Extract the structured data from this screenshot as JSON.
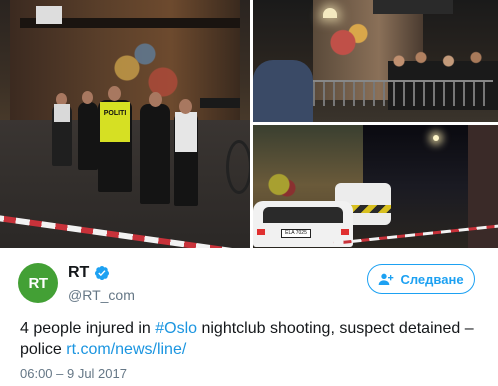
{
  "photos": {
    "main": {
      "vest_text": "POLITI"
    },
    "bottom_right": {
      "plate_text": "ELA 7025"
    }
  },
  "tweet": {
    "author_name": "RT",
    "avatar_text": "RT",
    "handle": "@RT_com",
    "follow_label": "Следване",
    "text_prefix": "4 people injured in ",
    "hashtag": "#Oslo",
    "text_mid": " nightclub shooting, suspect detained – police ",
    "link": "rt.com/news/line/",
    "timestamp": "06:00 – 9 Jul 2017"
  },
  "colors": {
    "accent": "#1da1f2",
    "link": "#1b95e0",
    "avatar_bg": "#43a035",
    "text": "#14171a",
    "muted": "#657786"
  },
  "icons": {
    "verified": "verified-badge-icon",
    "follow": "add-user-icon"
  }
}
